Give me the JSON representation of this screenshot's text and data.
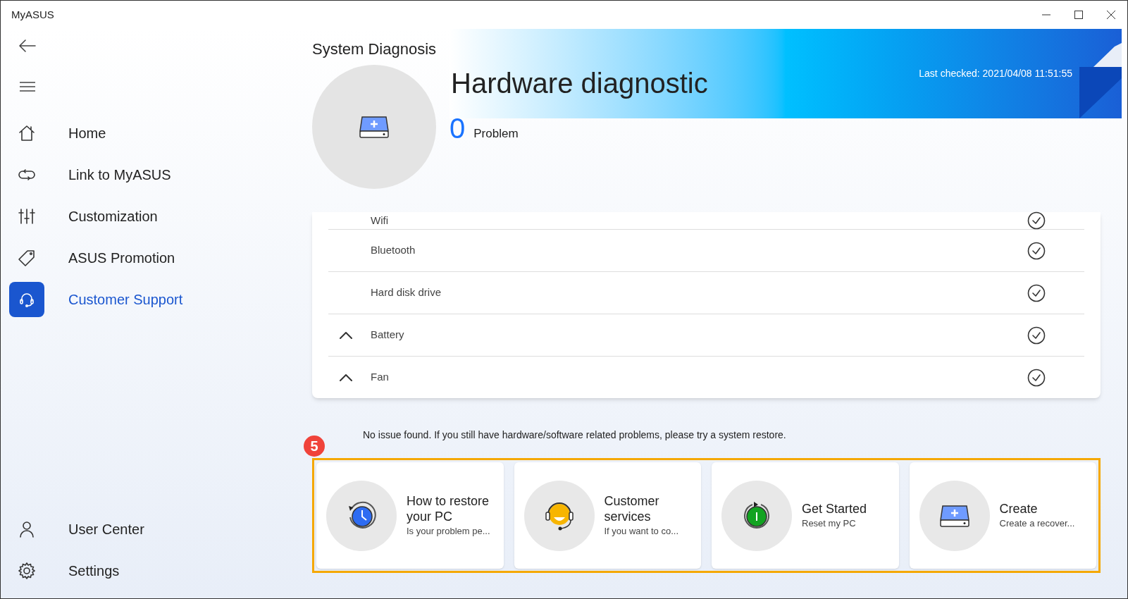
{
  "window": {
    "title": "MyASUS"
  },
  "sidebar": {
    "items": [
      {
        "label": "Home",
        "kind": "home",
        "selected": false
      },
      {
        "label": "Link to MyASUS",
        "kind": "link",
        "selected": false
      },
      {
        "label": "Customization",
        "kind": "sliders",
        "selected": false
      },
      {
        "label": "ASUS Promotion",
        "kind": "tag",
        "selected": false
      },
      {
        "label": "Customer Support",
        "kind": "headset",
        "selected": true
      }
    ],
    "bottom_items": [
      {
        "label": "User Center",
        "kind": "user",
        "selected": false
      },
      {
        "label": "Settings",
        "kind": "gear",
        "selected": false
      }
    ]
  },
  "page": {
    "title": "System Diagnosis",
    "heading": "Hardware diagnostic",
    "problem_count": "0",
    "problem_label": "Problem",
    "last_checked": "Last checked: 2021/04/08 11:51:55"
  },
  "checks": [
    {
      "label": "Wifi",
      "expandable": false,
      "passed": true
    },
    {
      "label": "Bluetooth",
      "expandable": false,
      "passed": true
    },
    {
      "label": "Hard disk drive",
      "expandable": false,
      "passed": true
    },
    {
      "label": "Battery",
      "expandable": true,
      "passed": true
    },
    {
      "label": "Fan",
      "expandable": true,
      "passed": true
    }
  ],
  "notice": "No issue found. If you still have hardware/software related problems, please try a system restore.",
  "annotation": {
    "number": "5"
  },
  "cards": [
    {
      "kind": "clock",
      "title": "How to restore your PC",
      "subtitle": "Is your problem pe..."
    },
    {
      "kind": "agent",
      "title": "Customer services",
      "subtitle": "If you want to co..."
    },
    {
      "kind": "power",
      "title": "Get Started",
      "subtitle": "Reset my PC"
    },
    {
      "kind": "drive",
      "title": "Create",
      "subtitle": "Create a recover..."
    }
  ]
}
